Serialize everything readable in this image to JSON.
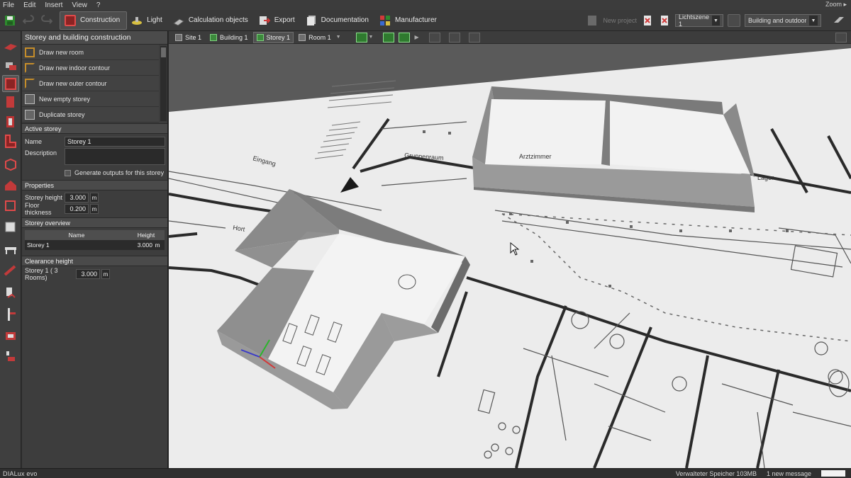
{
  "menu": {
    "file": "File",
    "edit": "Edit",
    "insert": "Insert",
    "view": "View",
    "help": "?",
    "zoom": "Zoom ▸"
  },
  "ribbon": {
    "tabs": [
      {
        "label": "Construction",
        "active": true
      },
      {
        "label": "Light"
      },
      {
        "label": "Calculation objects"
      },
      {
        "label": "Export"
      },
      {
        "label": "Documentation"
      },
      {
        "label": "Manufacturer"
      }
    ],
    "new_project_label": "New project",
    "light_scene": "Lichtszene 1",
    "view_mode": "Building and outdoor pla..."
  },
  "panel": {
    "title": "Storey and building construction",
    "actions": [
      "Draw new room",
      "Draw new indoor contour",
      "Draw new outer contour",
      "New empty storey",
      "Duplicate storey"
    ],
    "active_storey": {
      "heading": "Active storey",
      "name_label": "Name",
      "name_value": "Storey 1",
      "description_label": "Description",
      "description_value": "",
      "generate_outputs_label": "Generate outputs for this storey"
    },
    "properties": {
      "heading": "Properties",
      "storey_height_label": "Storey height",
      "storey_height_value": "3.000",
      "floor_thickness_label": "Floor thickness",
      "floor_thickness_value": "0.200",
      "unit": "m"
    },
    "overview": {
      "heading": "Storey overview",
      "col_name": "Name",
      "col_height": "Height",
      "rows": [
        {
          "name": "Storey 1",
          "height": "3.000",
          "unit": "m"
        }
      ]
    },
    "clearance": {
      "heading": "Clearance height",
      "label": "Storey 1 ( 3 Rooms)",
      "value": "3.000",
      "unit": "m"
    }
  },
  "breadcrumb": {
    "site": "Site 1",
    "building": "Building 1",
    "storey": "Storey 1",
    "room": "Room 1"
  },
  "plan_labels": {
    "gruppenraum": "Gruppenraum",
    "arztzimmer": "Arztzimmer",
    "eingang": "Eingang",
    "hort": "Hort",
    "lager": "Lager"
  },
  "status": {
    "logo": "DIALux evo",
    "memory": "Verwalteter Speicher 103MB",
    "messages": "1 new message"
  },
  "colors": {
    "accent_red": "#d23a3a",
    "accent_green": "#3c8a3c",
    "panel_bg": "#3d3d3d"
  }
}
